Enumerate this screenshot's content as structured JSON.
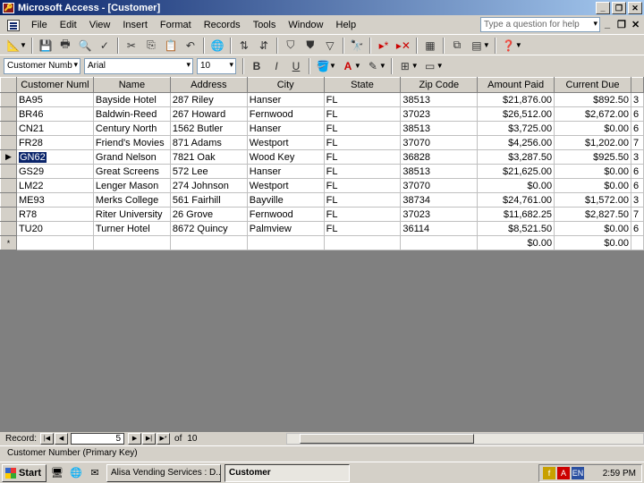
{
  "window": {
    "title": "Microsoft Access - [Customer]"
  },
  "menu": [
    "File",
    "Edit",
    "View",
    "Insert",
    "Format",
    "Records",
    "Tools",
    "Window",
    "Help"
  ],
  "help_placeholder": "Type a question for help",
  "format_bar": {
    "field": "Customer Numb",
    "font": "Arial",
    "size": "10"
  },
  "columns": [
    "Customer Numl",
    "Name",
    "Address",
    "City",
    "State",
    "Zip Code",
    "Amount Paid",
    "Current Due",
    ""
  ],
  "rows": [
    {
      "sel": "",
      "cells": [
        "BA95",
        "Bayside Hotel",
        "287 Riley",
        "Hanser",
        "FL",
        "38513",
        "$21,876.00",
        "$892.50",
        "3"
      ]
    },
    {
      "sel": "",
      "cells": [
        "BR46",
        "Baldwin-Reed",
        "267 Howard",
        "Fernwood",
        "FL",
        "37023",
        "$26,512.00",
        "$2,672.00",
        "6"
      ]
    },
    {
      "sel": "",
      "cells": [
        "CN21",
        "Century North",
        "1562 Butler",
        "Hanser",
        "FL",
        "38513",
        "$3,725.00",
        "$0.00",
        "6"
      ]
    },
    {
      "sel": "",
      "cells": [
        "FR28",
        "Friend's Movies",
        "871 Adams",
        "Westport",
        "FL",
        "37070",
        "$4,256.00",
        "$1,202.00",
        "7"
      ]
    },
    {
      "sel": "▶",
      "cells": [
        "GN62",
        "Grand Nelson",
        "7821 Oak",
        "Wood Key",
        "FL",
        "36828",
        "$3,287.50",
        "$925.50",
        "3"
      ]
    },
    {
      "sel": "",
      "cells": [
        "GS29",
        "Great Screens",
        "572 Lee",
        "Hanser",
        "FL",
        "38513",
        "$21,625.00",
        "$0.00",
        "6"
      ]
    },
    {
      "sel": "",
      "cells": [
        "LM22",
        "Lenger Mason",
        "274 Johnson",
        "Westport",
        "FL",
        "37070",
        "$0.00",
        "$0.00",
        "6"
      ]
    },
    {
      "sel": "",
      "cells": [
        "ME93",
        "Merks College",
        "561 Fairhill",
        "Bayville",
        "FL",
        "38734",
        "$24,761.00",
        "$1,572.00",
        "3"
      ]
    },
    {
      "sel": "",
      "cells": [
        "R78",
        "Riter University",
        "26 Grove",
        "Fernwood",
        "FL",
        "37023",
        "$11,682.25",
        "$2,827.50",
        "7"
      ]
    },
    {
      "sel": "",
      "cells": [
        "TU20",
        "Turner Hotel",
        "8672 Quincy",
        "Palmview",
        "FL",
        "36114",
        "$8,521.50",
        "$0.00",
        "6"
      ]
    },
    {
      "sel": "*",
      "cells": [
        "",
        "",
        "",
        "",
        "",
        "",
        "$0.00",
        "$0.00",
        ""
      ]
    }
  ],
  "nav": {
    "label": "Record:",
    "current": "5",
    "of_label": "of",
    "total": "10"
  },
  "status": "Customer Number (Primary Key)",
  "taskbar": {
    "start": "Start",
    "tasks": [
      "Alisa Vending Services : D...",
      "Customer"
    ],
    "lang": "EN",
    "clock": "2:59 PM"
  }
}
